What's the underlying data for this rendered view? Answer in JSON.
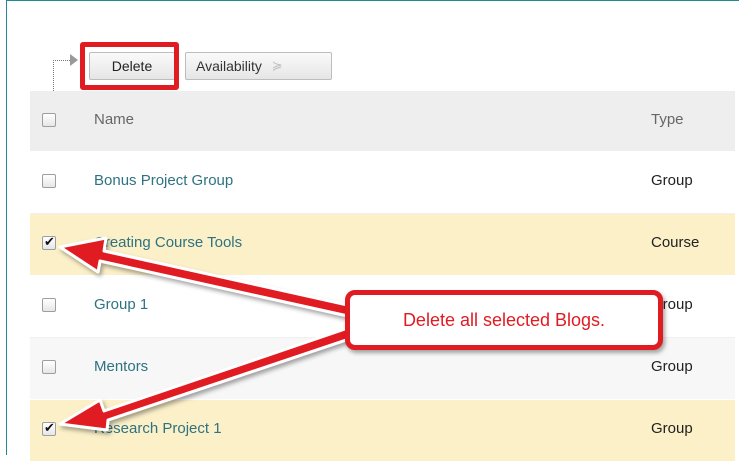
{
  "toolbar": {
    "delete_label": "Delete",
    "availability_label": "Availability",
    "availability_icon": "chevron-down-icon"
  },
  "table": {
    "columns": [
      "Name",
      "Type"
    ],
    "rows": [
      {
        "name": "Bonus Project Group",
        "type": "Group",
        "checked": false
      },
      {
        "name": "Creating Course Tools",
        "type": "Course",
        "checked": true
      },
      {
        "name": "Group 1",
        "type": "Group",
        "checked": false
      },
      {
        "name": "Mentors",
        "type": "Group",
        "checked": false
      },
      {
        "name": "Research Project 1",
        "type": "Group",
        "checked": true
      }
    ]
  },
  "callout": {
    "text": "Delete all selected Blogs."
  },
  "colors": {
    "highlight": "#e01b22",
    "link": "#2e7382",
    "selected_row": "#fbf0c8"
  }
}
